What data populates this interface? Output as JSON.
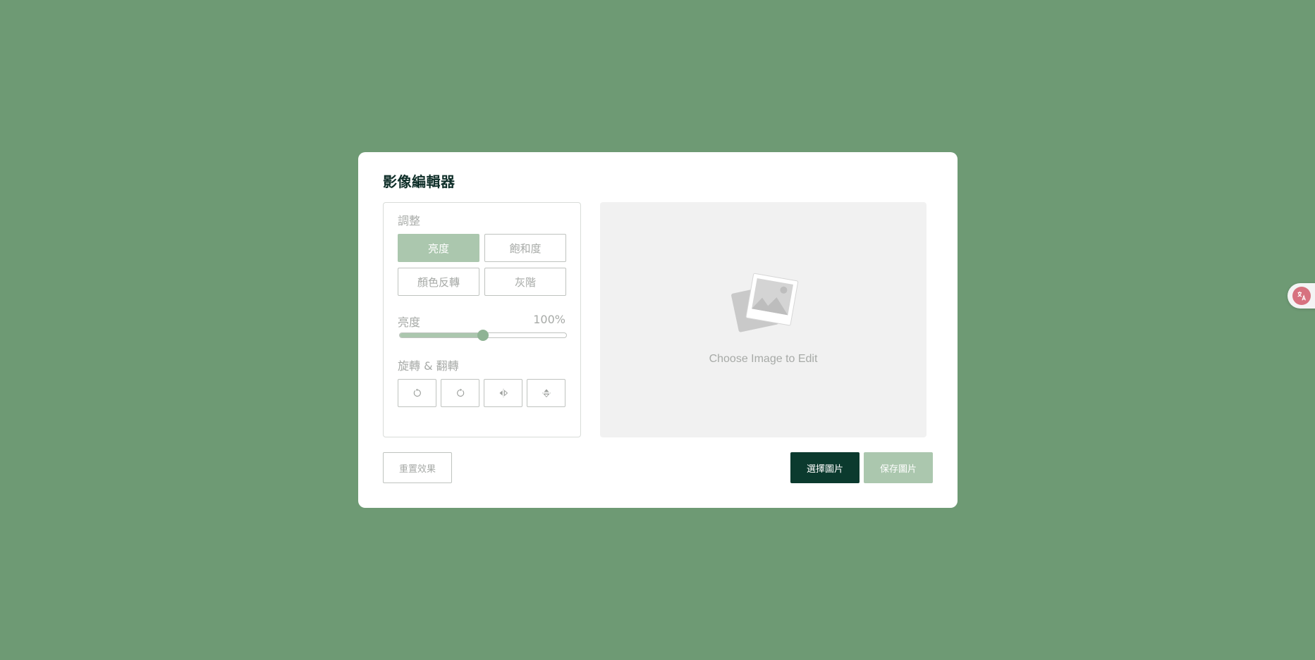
{
  "editor": {
    "title": "影像編輯器",
    "adjust_label": "調整",
    "filters": [
      {
        "label": "亮度",
        "active": true
      },
      {
        "label": "飽和度",
        "active": false
      },
      {
        "label": "顏色反轉",
        "active": false
      },
      {
        "label": "灰階",
        "active": false
      }
    ],
    "slider": {
      "label": "亮度",
      "value_text": "100%",
      "fraction": 0.5
    },
    "rotate_label": "旋轉 & 翻轉",
    "tools": [
      "rotate-left-icon",
      "rotate-right-icon",
      "flip-horizontal-icon",
      "flip-vertical-icon"
    ],
    "preview": {
      "placeholder": "Choose Image to Edit"
    },
    "buttons": {
      "reset": "重置效果",
      "choose": "選擇圖片",
      "save": "保存圖片"
    }
  },
  "colors": {
    "background": "#6e9a74",
    "accent": "#abc7ae",
    "primary_dark": "#0b3a2e"
  }
}
